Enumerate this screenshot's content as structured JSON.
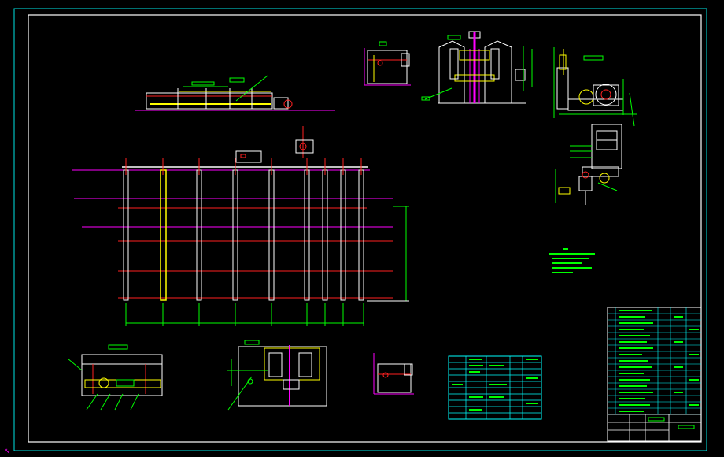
{
  "drawing": {
    "background": "#000000",
    "palette": {
      "border": "#00e5e5",
      "main_line": "#ffffff",
      "yellow": "#ffff00",
      "red": "#ff2020",
      "magenta": "#ff00ff",
      "green": "#00ff00",
      "cyan": "#00ffff",
      "text_green": "#00ff00"
    },
    "ucs_icon": "ucs-arrow-icon"
  }
}
